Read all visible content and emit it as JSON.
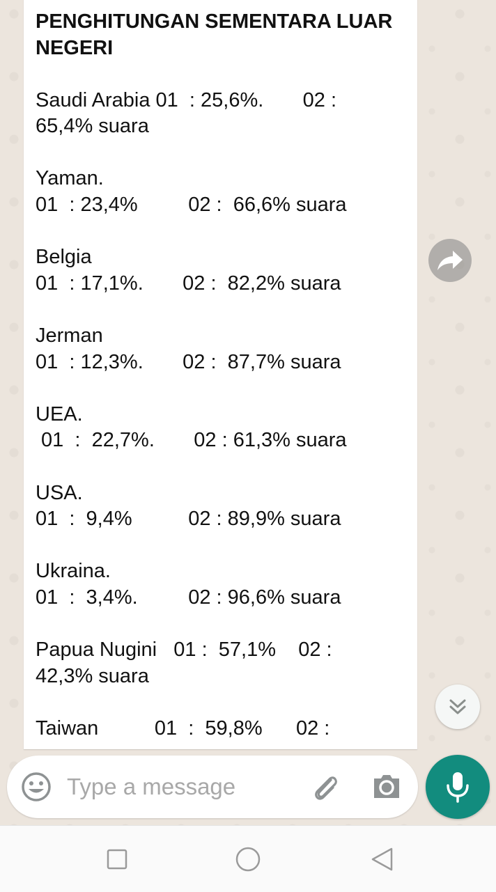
{
  "message": {
    "title": "PENGHITUNGAN SEMENTARA LUAR NEGERI",
    "lines": [
      "Saudi Arabia 01  : 25,6%.       02 :",
      "65,4% suara",
      "",
      "Yaman.",
      "01  : 23,4%         02 :  66,6% suara",
      "",
      "Belgia",
      "01  : 17,1%.       02 :  82,2% suara",
      "",
      "Jerman",
      "01  : 12,3%.       02 :  87,7% suara",
      "",
      "UEA.",
      " 01  :  22,7%.       02 : 61,3% suara",
      "",
      "USA.",
      "01  :  9,4%          02 : 89,9% suara",
      "",
      "Ukraina.",
      "01  :  3,4%.         02 : 96,6% suara",
      "",
      "Papua Nugini   01 :  57,1%    02 :",
      "42,3% suara",
      "",
      "Taiwan          01  :  59,8%      02 :"
    ]
  },
  "composer": {
    "placeholder": "Type a message"
  },
  "icons": {
    "forward": "forward-arrow-icon",
    "scroll_down": "double-chevron-down-icon",
    "emoji": "smiley-icon",
    "attach": "paperclip-icon",
    "camera": "camera-icon",
    "mic": "microphone-icon",
    "nav_recent": "square-icon",
    "nav_home": "circle-icon",
    "nav_back": "triangle-back-icon"
  },
  "colors": {
    "chat_background": "#ece5dd",
    "accent": "#128c7e",
    "bubble": "#ffffff"
  }
}
